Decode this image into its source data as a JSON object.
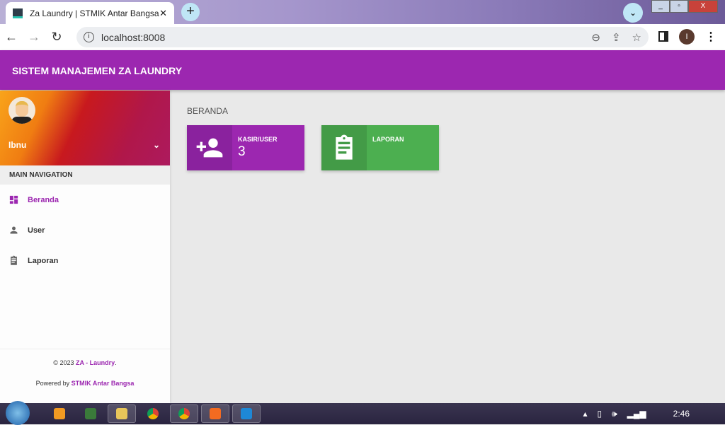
{
  "browser": {
    "tab_title": "Za Laundry | STMIK Antar Bangsa",
    "url": "localhost:8008",
    "profile_initial": "I"
  },
  "header": {
    "title": "SISTEM MANAJEMEN ZA LAUNDRY"
  },
  "sidebar": {
    "user_name": "Ibnu",
    "nav_header": "MAIN NAVIGATION",
    "items": [
      {
        "label": "Beranda",
        "icon": "dashboard-icon"
      },
      {
        "label": "User",
        "icon": "person-icon"
      },
      {
        "label": "Laporan",
        "icon": "clipboard-icon"
      }
    ],
    "footer": {
      "copyright": "© 2023 ",
      "brand": "ZA - Laundry",
      "dot": ".",
      "powered": "Powered by ",
      "company": "STMIK Antar Bangsa"
    }
  },
  "main": {
    "title": "BERANDA",
    "boxes": [
      {
        "label": "KASIR/USER",
        "value": "3",
        "color": "#9c27b0"
      },
      {
        "label": "LAPORAN",
        "value": "",
        "color": "#4caf50"
      }
    ]
  },
  "taskbar": {
    "time": "2:46"
  }
}
